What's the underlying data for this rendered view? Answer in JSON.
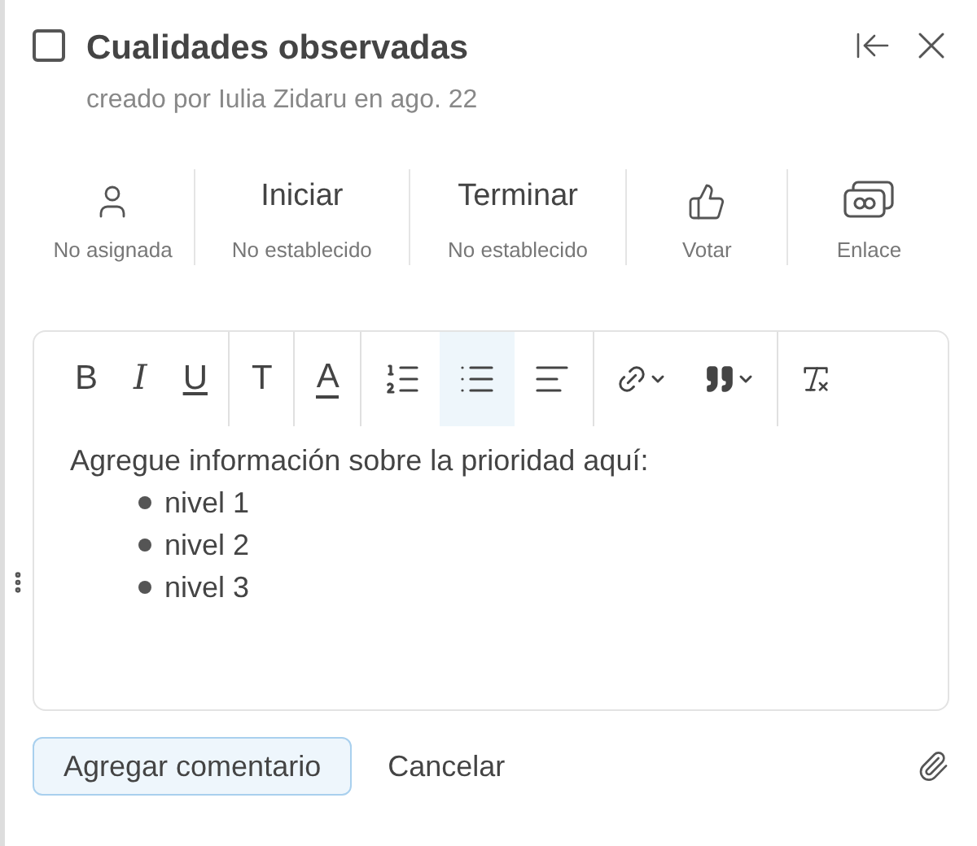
{
  "task": {
    "checked": false,
    "title": "Cualidades observadas",
    "subtitle": "creado por Iulia Zidaru en ago. 22"
  },
  "meta": [
    {
      "kind": "assignee",
      "caption": "No asignada"
    },
    {
      "kind": "date",
      "heading": "Iniciar",
      "caption": "No establecido"
    },
    {
      "kind": "date",
      "heading": "Terminar",
      "caption": "No establecido"
    },
    {
      "kind": "vote",
      "caption": "Votar"
    },
    {
      "kind": "link",
      "caption": "Enlace"
    }
  ],
  "toolbar": [
    [
      {
        "kind": "bold",
        "label": "B",
        "selected": false
      },
      {
        "kind": "italic",
        "label": "I",
        "selected": false
      },
      {
        "kind": "underline",
        "label": "U",
        "selected": false
      }
    ],
    [
      {
        "kind": "heading",
        "label": "T",
        "selected": false
      }
    ],
    [
      {
        "kind": "color",
        "label": "A",
        "selected": false
      }
    ],
    [
      {
        "kind": "ordered-list",
        "selected": false
      },
      {
        "kind": "bullet-list",
        "selected": true
      },
      {
        "kind": "align",
        "selected": false
      }
    ],
    [
      {
        "kind": "link",
        "selected": false
      },
      {
        "kind": "quote",
        "selected": false
      }
    ],
    [
      {
        "kind": "clear-format",
        "selected": false
      }
    ]
  ],
  "editor": {
    "intro": "Agregue información sobre la prioridad aquí:",
    "items": [
      "nivel 1",
      "nivel 2",
      "nivel 3"
    ]
  },
  "actions": {
    "submit": "Agregar comentario",
    "cancel": "Cancelar"
  }
}
